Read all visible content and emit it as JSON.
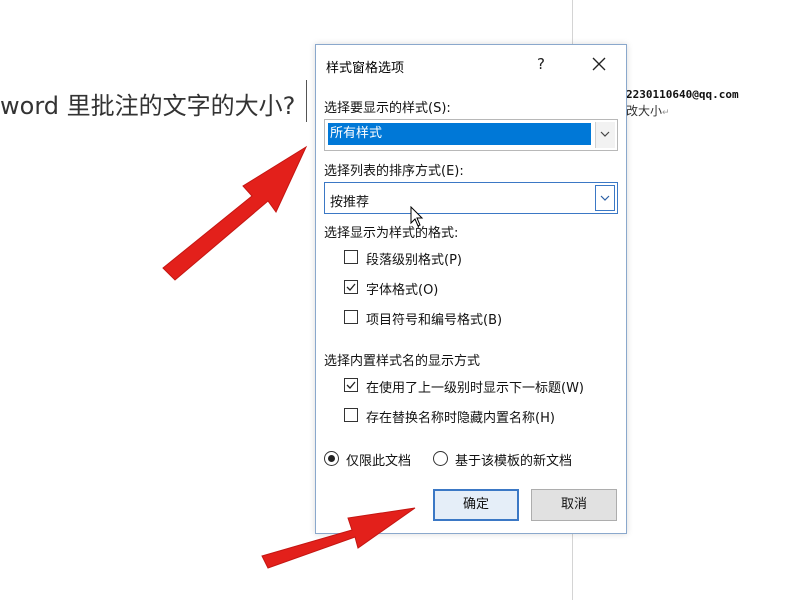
{
  "document": {
    "text": "word 里批注的文字的大小?",
    "paragraph_mark": "↵",
    "comment_email": "2230110640@qq.com",
    "comment_text": "改大小",
    "comment_mark": "↵"
  },
  "dialog": {
    "title": "样式窗格选项",
    "help_label": "?",
    "select_styles_label": "选择要显示的样式(S):",
    "select_styles_value": "所有样式",
    "sort_label": "选择列表的排序方式(E):",
    "sort_value": "按推荐",
    "format_section_label": "选择显示为样式的格式:",
    "checkboxes_format": [
      {
        "label": "段落级别格式(P)",
        "checked": false
      },
      {
        "label": "字体格式(O)",
        "checked": true
      },
      {
        "label": "项目符号和编号格式(B)",
        "checked": false
      }
    ],
    "builtin_section_label": "选择内置样式名的显示方式",
    "checkboxes_builtin": [
      {
        "label": "在使用了上一级别时显示下一标题(W)",
        "checked": true
      },
      {
        "label": "存在替换名称时隐藏内置名称(H)",
        "checked": false
      }
    ],
    "radio_options": [
      {
        "label": "仅限此文档",
        "selected": true
      },
      {
        "label": "基于该模板的新文档",
        "selected": false
      }
    ],
    "ok_label": "确定",
    "cancel_label": "取消"
  },
  "colors": {
    "selection": "#0078d7",
    "annotation_arrow": "#e3201b",
    "dialog_border": "#8aa8cc"
  }
}
